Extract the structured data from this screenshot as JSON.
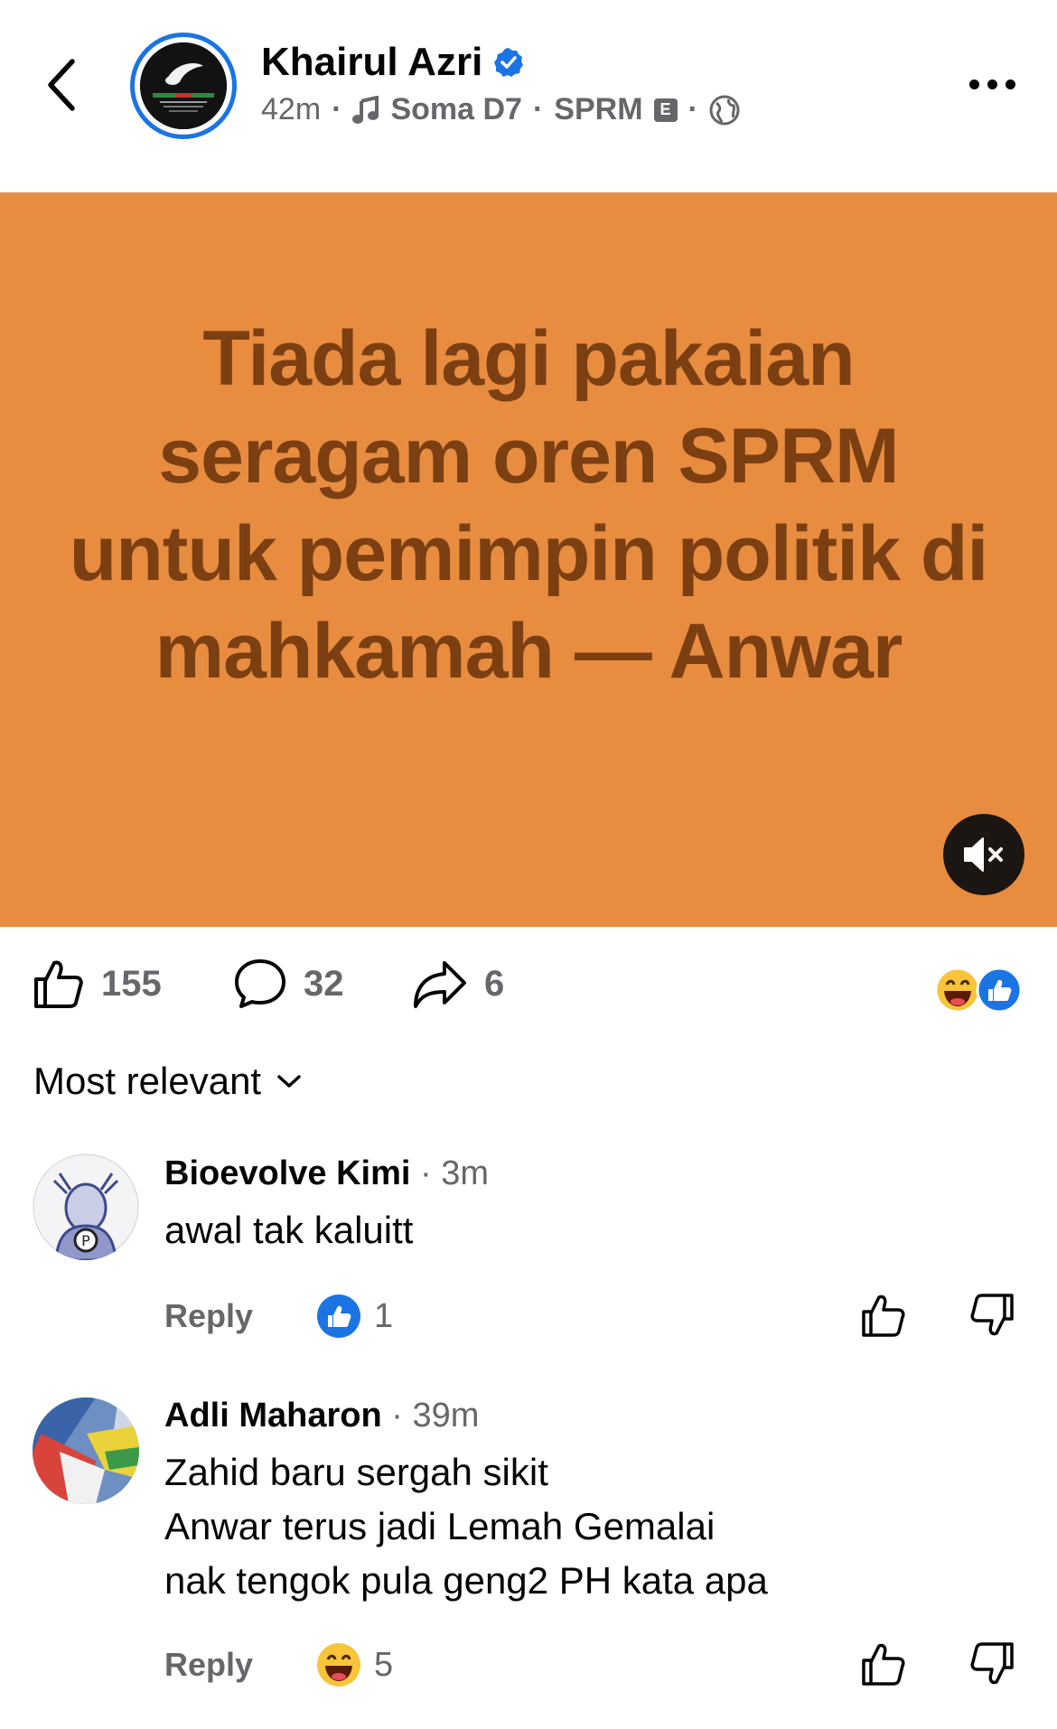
{
  "header": {
    "author": "Khairul Azri",
    "time": "42m",
    "music": "Soma D7",
    "music_artist": "SPRM",
    "explicit_badge": "E",
    "verified_icon": "verified-badge-icon",
    "privacy_icon": "globe-icon"
  },
  "post": {
    "headline": "Tiada lagi pakaian seragam oren SPRM untuk pemimpin politik di mahkamah — Anwar",
    "background_color": "#e88c40",
    "text_color": "#7b3f12"
  },
  "stats": {
    "likes": "155",
    "comments": "32",
    "shares": "6",
    "reaction_icons": [
      "laughing-emoji-icon",
      "like-reaction-icon"
    ]
  },
  "sort": {
    "label": "Most relevant"
  },
  "comments": [
    {
      "name": "Bioevolve Kimi",
      "ago": "· 3m",
      "lines": [
        "awal tak kaluitt"
      ],
      "reply_label": "Reply",
      "reaction_icon": "like-reaction-icon",
      "reaction_count": "1"
    },
    {
      "name": "Adli Maharon",
      "ago": "· 39m",
      "lines": [
        "Zahid baru sergah sikit",
        "Anwar terus jadi Lemah Gemalai",
        "nak tengok pula geng2 PH kata apa"
      ],
      "reply_label": "Reply",
      "reaction_icon": "laughing-emoji-icon",
      "reaction_count": "5"
    }
  ],
  "colors": {
    "accent": "#1b74e4",
    "secondary_text": "#65676b"
  }
}
